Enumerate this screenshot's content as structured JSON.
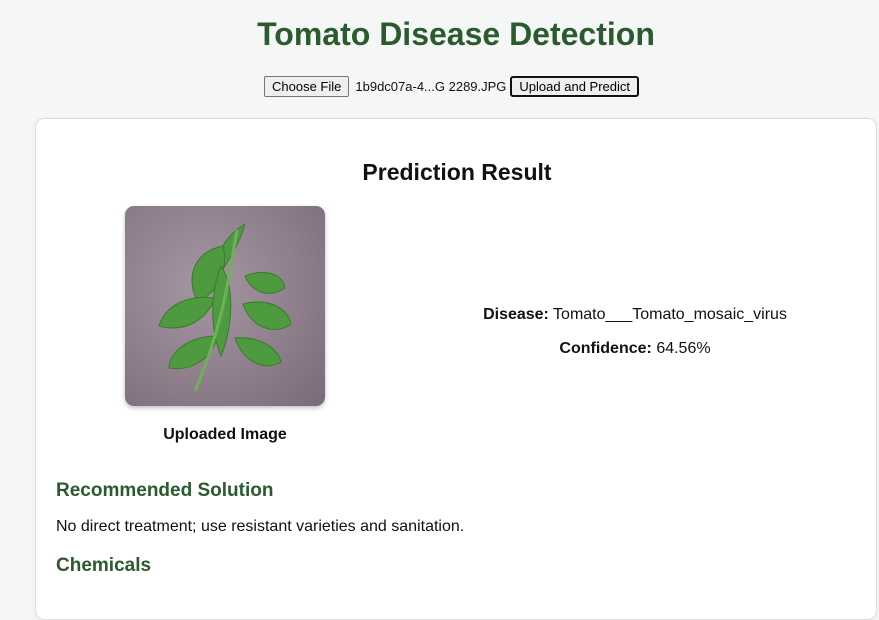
{
  "page": {
    "title": "Tomato Disease Detection"
  },
  "upload": {
    "choose_label": "Choose File",
    "file_name": "1b9dc07a-4...G 2289.JPG",
    "submit_label": "Upload and Predict"
  },
  "result": {
    "heading": "Prediction Result",
    "image_caption": "Uploaded Image",
    "disease_label": "Disease:",
    "disease_value": "Tomato___Tomato_mosaic_virus",
    "confidence_label": "Confidence:",
    "confidence_value": "64.56%"
  },
  "solution": {
    "heading": "Recommended Solution",
    "text": "No direct treatment; use resistant varieties and sanitation."
  },
  "chemicals": {
    "heading": "Chemicals"
  },
  "colors": {
    "heading_green": "#2a5a2e",
    "leaf_green": "#4e9a3e",
    "background": "#f5f7f6"
  }
}
